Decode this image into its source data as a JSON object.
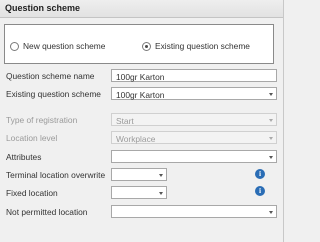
{
  "header": {
    "title": "Question scheme"
  },
  "mode": {
    "options": [
      {
        "label": "New question scheme",
        "selected": false
      },
      {
        "label": "Existing question scheme",
        "selected": true
      }
    ]
  },
  "fields": {
    "question_scheme_name": {
      "label": "Question scheme name",
      "value": "100gr Karton"
    },
    "existing_question_scheme": {
      "label": "Existing question scheme",
      "value": "100gr Karton"
    },
    "type_of_registration": {
      "label": "Type of registration",
      "value": "Start"
    },
    "location_level": {
      "label": "Location level",
      "value": "Workplace"
    },
    "attributes": {
      "label": "Attributes",
      "value": ""
    },
    "terminal_location_overwrite": {
      "label": "Terminal location overwrite",
      "value": ""
    },
    "fixed_location": {
      "label": "Fixed location",
      "value": ""
    },
    "not_permitted_location": {
      "label": "Not permitted location",
      "value": ""
    }
  },
  "icons": {
    "info": "info-icon",
    "info_glyph": "i",
    "info_color": "#2a6db5"
  }
}
